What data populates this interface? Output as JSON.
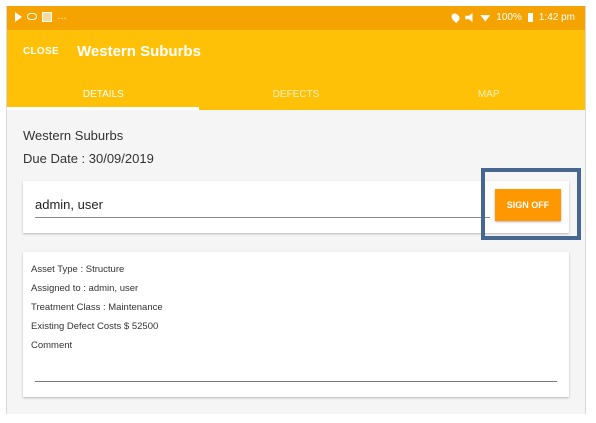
{
  "status_bar": {
    "battery": "100%",
    "time": "1:42 pm"
  },
  "app_bar": {
    "close_label": "CLOSE",
    "title": "Western Suburbs"
  },
  "tabs": [
    {
      "label": "DETAILS",
      "active": true
    },
    {
      "label": "DEFECTS",
      "active": false
    },
    {
      "label": "MAP",
      "active": false
    }
  ],
  "details": {
    "site_name": "Western Suburbs",
    "due_date": "Due Date : 30/09/2019"
  },
  "signoff_card": {
    "user_value": "admin, user",
    "button_label": "SIGN OFF"
  },
  "info_card": {
    "asset_type": "Asset Type : Structure",
    "assigned_to": "Assigned to :  admin, user",
    "treatment_class": "Treatment Class :  Maintenance",
    "defect_costs": "Existing Defect Costs $  52500",
    "comment_label": "Comment"
  },
  "colors": {
    "status_bar": "#f5a300",
    "app_bar": "#ffc107",
    "sign_off_button": "#ff9800",
    "highlight_box": "#46678f"
  }
}
